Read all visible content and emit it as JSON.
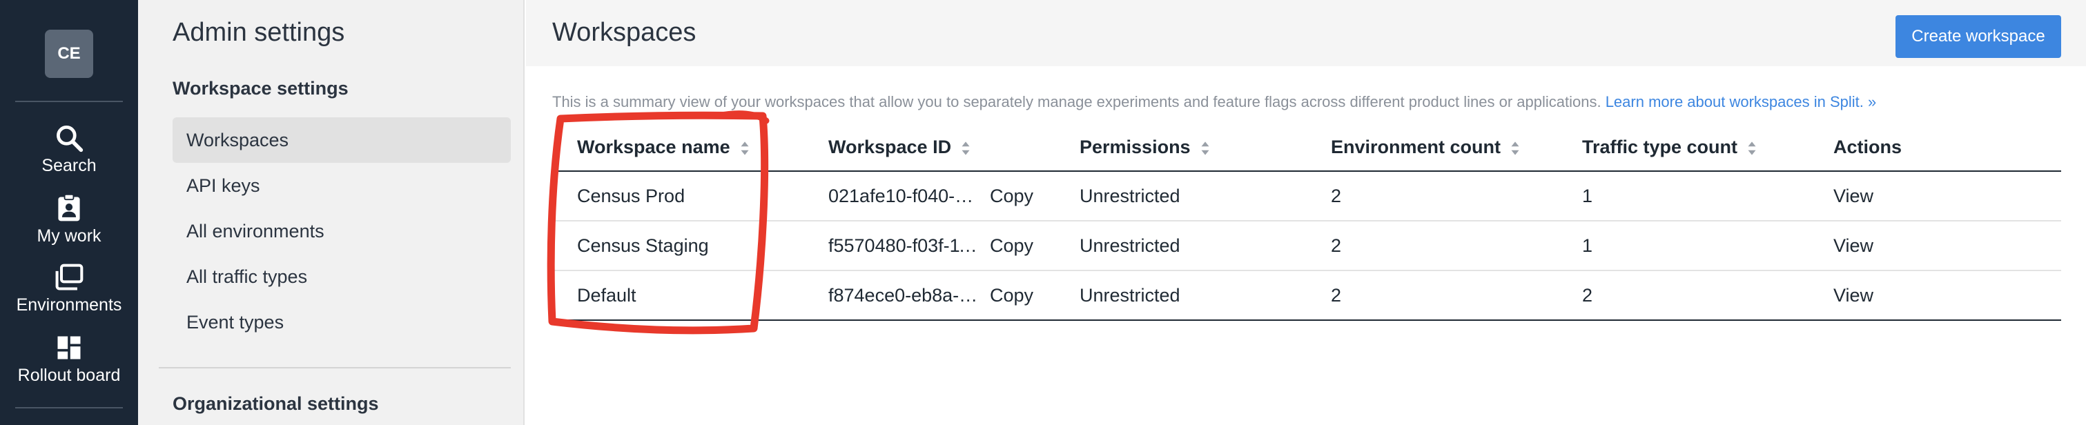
{
  "rail": {
    "avatar": "CE",
    "items": [
      {
        "label": "Search",
        "icon": "search-icon"
      },
      {
        "label": "My work",
        "icon": "clipboard-user-icon"
      },
      {
        "label": "Environments",
        "icon": "environments-icon"
      },
      {
        "label": "Rollout board",
        "icon": "dashboard-icon"
      }
    ]
  },
  "subnav": {
    "title": "Admin settings",
    "workspace_heading": "Workspace settings",
    "items": [
      "Workspaces",
      "API keys",
      "All environments",
      "All traffic types",
      "Event types"
    ],
    "org_heading": "Organizational settings"
  },
  "main": {
    "title": "Workspaces",
    "create_button": "Create workspace",
    "summary": "This is a summary view of your workspaces that allow you to separately manage experiments and feature flags across different product lines or applications.",
    "summary_link": "Learn more about workspaces in Split. »",
    "columns": [
      "Workspace name",
      "Workspace ID",
      "Permissions",
      "Environment count",
      "Traffic type count",
      "Actions"
    ],
    "rows": [
      {
        "name": "Census Prod",
        "id": "021afe10-f040-1…",
        "copy": "Copy",
        "permissions": "Unrestricted",
        "env_count": "2",
        "traffic_count": "1",
        "action": "View"
      },
      {
        "name": "Census Staging",
        "id": "f5570480-f03f-11…",
        "copy": "Copy",
        "permissions": "Unrestricted",
        "env_count": "2",
        "traffic_count": "1",
        "action": "View"
      },
      {
        "name": "Default",
        "id": "f874ece0-eb8a-1…",
        "copy": "Copy",
        "permissions": "Unrestricted",
        "env_count": "2",
        "traffic_count": "2",
        "action": "View"
      }
    ]
  },
  "colors": {
    "rail_bg": "#1b2736",
    "accent": "#3d86e0",
    "annotation": "#e8392b"
  }
}
